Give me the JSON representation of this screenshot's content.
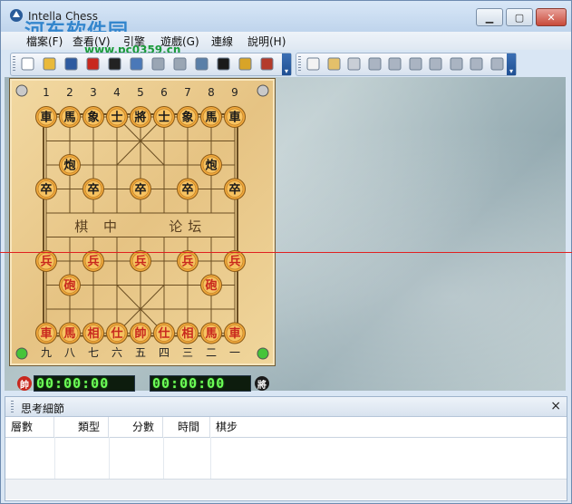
{
  "window": {
    "title": "Intella Chess",
    "watermark": "河东软件园",
    "watermark_url": "www.pc0359.cn",
    "minimize_glyph": "▁",
    "maximize_glyph": "▢",
    "close_glyph": "✕"
  },
  "menu": {
    "items": [
      {
        "label": "檔案(F)"
      },
      {
        "label": "查看(V)"
      },
      {
        "label": "引擎"
      },
      {
        "label": "遊戲(G)"
      },
      {
        "label": "連線"
      },
      {
        "label": "說明(H)"
      }
    ]
  },
  "toolbar1": {
    "buttons": [
      "new-game-icon",
      "open-folder-icon",
      "save-icon",
      "red-side-icon",
      "black-side-icon",
      "search-icon",
      "stop-icon",
      "refresh-icon",
      "edit-board-icon",
      "flag-icon",
      "lock-icon",
      "hammer-icon"
    ],
    "overflow_glyph": "▾"
  },
  "toolbar2": {
    "buttons": [
      "copy-icon",
      "paste-icon",
      "paste-alt-icon",
      "undo-icon",
      "first-move-icon",
      "prev-fast-icon",
      "prev-move-icon",
      "next-move-icon",
      "next-fast-icon",
      "last-move-icon"
    ],
    "overflow_glyph": "▾"
  },
  "board": {
    "top_numbers": [
      "1",
      "2",
      "3",
      "4",
      "5",
      "6",
      "7",
      "8",
      "9"
    ],
    "bottom_numbers": [
      "九",
      "八",
      "七",
      "六",
      "五",
      "四",
      "三",
      "二",
      "一"
    ],
    "river_left": "棋 中",
    "river_right": "论坛",
    "pieces": [
      {
        "side": "black",
        "text": "車",
        "file": 0,
        "rank": 0
      },
      {
        "side": "black",
        "text": "馬",
        "file": 1,
        "rank": 0
      },
      {
        "side": "black",
        "text": "象",
        "file": 2,
        "rank": 0
      },
      {
        "side": "black",
        "text": "士",
        "file": 3,
        "rank": 0
      },
      {
        "side": "black",
        "text": "將",
        "file": 4,
        "rank": 0
      },
      {
        "side": "black",
        "text": "士",
        "file": 5,
        "rank": 0
      },
      {
        "side": "black",
        "text": "象",
        "file": 6,
        "rank": 0
      },
      {
        "side": "black",
        "text": "馬",
        "file": 7,
        "rank": 0
      },
      {
        "side": "black",
        "text": "車",
        "file": 8,
        "rank": 0
      },
      {
        "side": "black",
        "text": "炮",
        "file": 1,
        "rank": 2
      },
      {
        "side": "black",
        "text": "炮",
        "file": 7,
        "rank": 2
      },
      {
        "side": "black",
        "text": "卒",
        "file": 0,
        "rank": 3
      },
      {
        "side": "black",
        "text": "卒",
        "file": 2,
        "rank": 3
      },
      {
        "side": "black",
        "text": "卒",
        "file": 4,
        "rank": 3
      },
      {
        "side": "black",
        "text": "卒",
        "file": 6,
        "rank": 3
      },
      {
        "side": "black",
        "text": "卒",
        "file": 8,
        "rank": 3
      },
      {
        "side": "red",
        "text": "兵",
        "file": 0,
        "rank": 6
      },
      {
        "side": "red",
        "text": "兵",
        "file": 2,
        "rank": 6
      },
      {
        "side": "red",
        "text": "兵",
        "file": 4,
        "rank": 6
      },
      {
        "side": "red",
        "text": "兵",
        "file": 6,
        "rank": 6
      },
      {
        "side": "red",
        "text": "兵",
        "file": 8,
        "rank": 6
      },
      {
        "side": "red",
        "text": "砲",
        "file": 1,
        "rank": 7
      },
      {
        "side": "red",
        "text": "砲",
        "file": 7,
        "rank": 7
      },
      {
        "side": "red",
        "text": "車",
        "file": 0,
        "rank": 9
      },
      {
        "side": "red",
        "text": "馬",
        "file": 1,
        "rank": 9
      },
      {
        "side": "red",
        "text": "相",
        "file": 2,
        "rank": 9
      },
      {
        "side": "red",
        "text": "仕",
        "file": 3,
        "rank": 9
      },
      {
        "side": "red",
        "text": "帥",
        "file": 4,
        "rank": 9
      },
      {
        "side": "red",
        "text": "仕",
        "file": 5,
        "rank": 9
      },
      {
        "side": "red",
        "text": "相",
        "file": 6,
        "rank": 9
      },
      {
        "side": "red",
        "text": "馬",
        "file": 7,
        "rank": 9
      },
      {
        "side": "red",
        "text": "車",
        "file": 8,
        "rank": 9
      }
    ]
  },
  "clocks": {
    "red_badge": "帥",
    "red_time": "00:00:00",
    "black_time": "00:00:00",
    "black_badge": "將"
  },
  "panel": {
    "title": "思考細節",
    "close_glyph": "×",
    "columns": [
      "層數",
      "類型",
      "分數",
      "時間",
      "棋步"
    ]
  },
  "colors": {
    "red_piece_text": "#c8281e",
    "black_piece_text": "#1a1a1a",
    "piece_fill": "#f2a93b",
    "board_line": "#6b4e22"
  }
}
